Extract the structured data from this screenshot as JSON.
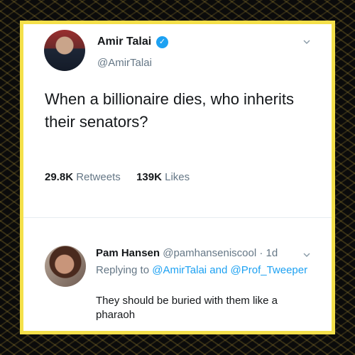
{
  "tweet": {
    "display_name": "Amir Talai",
    "handle": "@AmirTalai",
    "text": "When a billionaire dies, who inherits their senators?",
    "retweets_count": "29.8K",
    "retweets_label": "Retweets",
    "likes_count": "139K",
    "likes_label": "Likes"
  },
  "reply": {
    "display_name": "Pam Hansen",
    "handle": "@pamhanseniscool",
    "time": "· 1d",
    "replying_prefix": "Replying to",
    "replying_user_1": "@AmirTalai",
    "replying_and": "and",
    "replying_user_2": "@Prof_Tweeper",
    "text": "They should be buried with them like a pharaoh"
  },
  "colors": {
    "frame": "#f4e04a",
    "link": "#1da1f2",
    "muted": "#657786",
    "text": "#14171a"
  },
  "icons": {
    "verified": "verified-badge-icon",
    "chevron": "chevron-down-icon"
  }
}
